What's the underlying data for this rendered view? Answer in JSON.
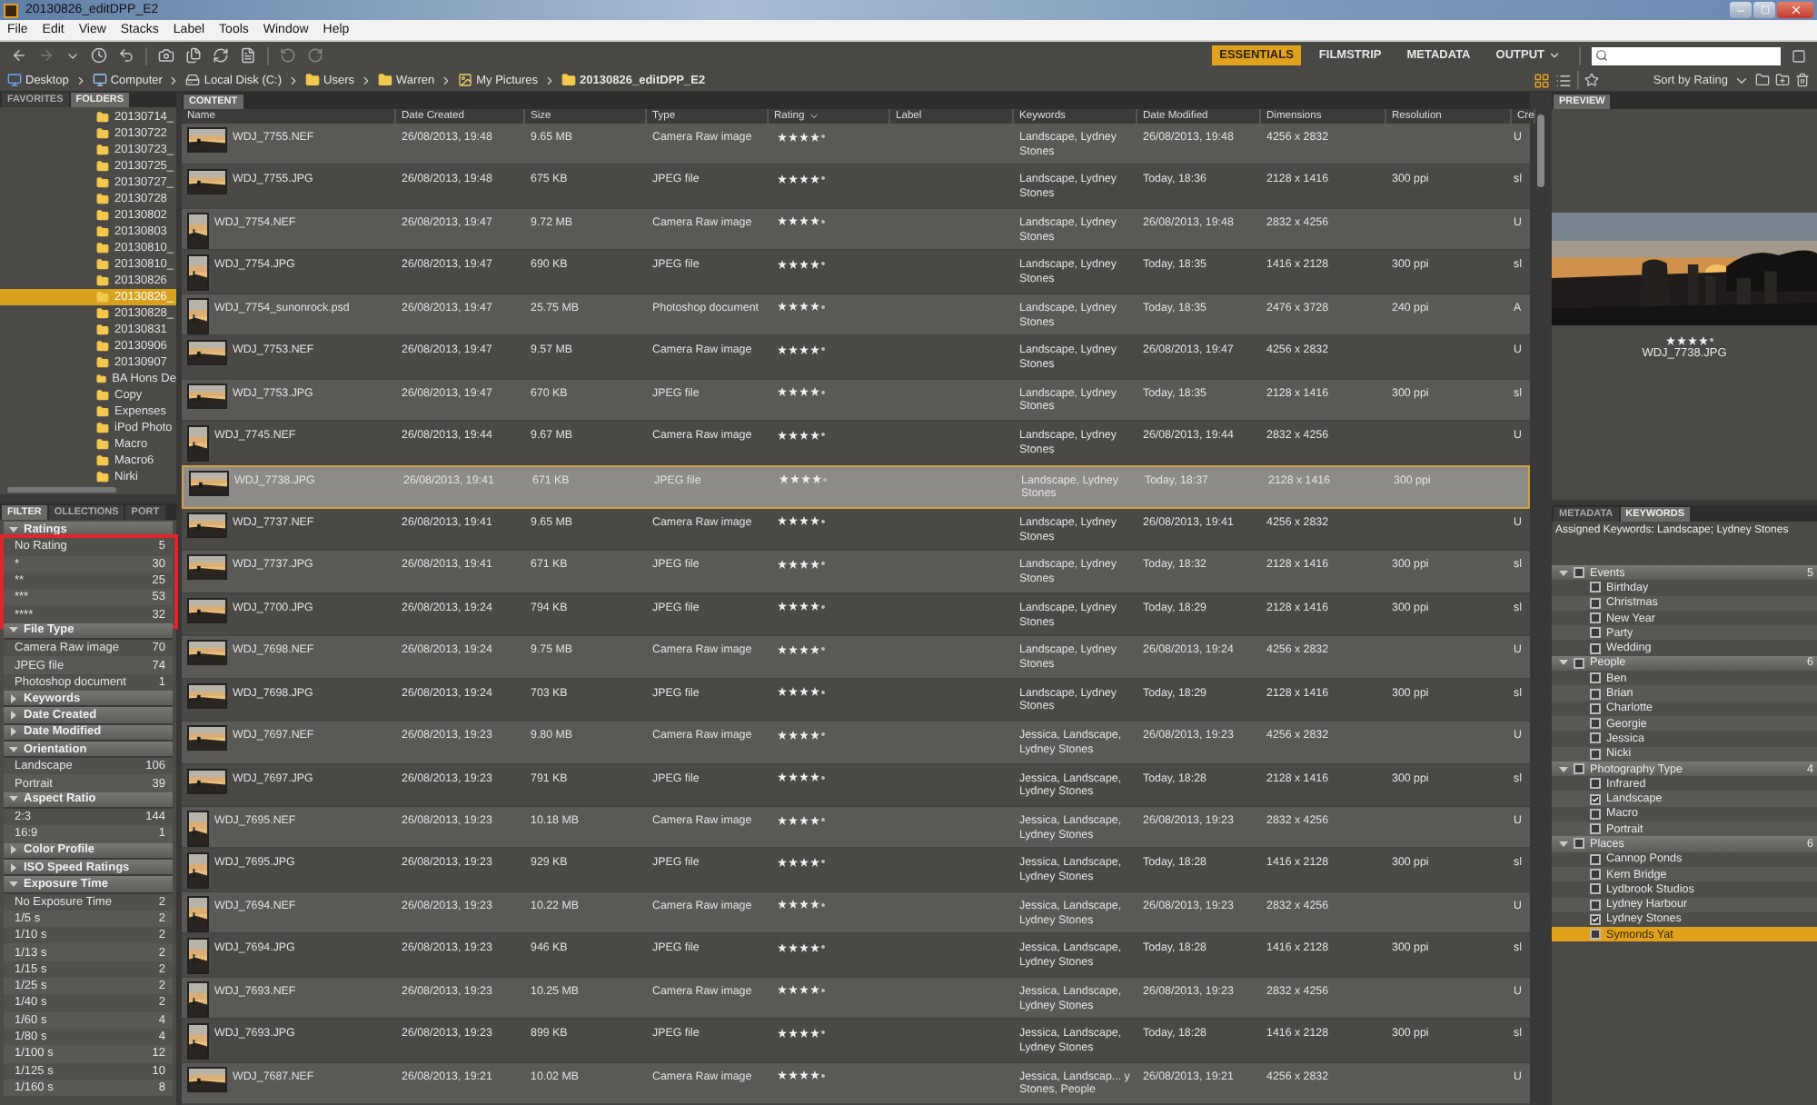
{
  "window": {
    "title": "20130826_editDPP_E2"
  },
  "menu": [
    "File",
    "Edit",
    "View",
    "Stacks",
    "Label",
    "Tools",
    "Window",
    "Help"
  ],
  "workspaces": [
    {
      "label": "ESSENTIALS",
      "selected": true
    },
    {
      "label": "FILMSTRIP",
      "selected": false
    },
    {
      "label": "METADATA",
      "selected": false
    },
    {
      "label": "OUTPUT",
      "selected": false
    }
  ],
  "path": [
    {
      "label": "Desktop",
      "kind": "desktop"
    },
    {
      "label": "Computer",
      "kind": "computer"
    },
    {
      "label": "Local Disk (C:)",
      "kind": "drive"
    },
    {
      "label": "Users",
      "kind": "folder"
    },
    {
      "label": "Warren",
      "kind": "folder"
    },
    {
      "label": "My Pictures",
      "kind": "pictures"
    },
    {
      "label": "20130826_editDPP_E2",
      "kind": "folder"
    }
  ],
  "sort": {
    "label": "Sort by Rating"
  },
  "folders_panel": {
    "tabs": [
      {
        "label": "FAVORITES",
        "selected": false
      },
      {
        "label": "FOLDERS",
        "selected": true
      }
    ],
    "items": [
      {
        "label": "20130714_",
        "selected": false
      },
      {
        "label": "20130722",
        "selected": false
      },
      {
        "label": "20130723_",
        "selected": false
      },
      {
        "label": "20130725_",
        "selected": false
      },
      {
        "label": "20130727_",
        "selected": false
      },
      {
        "label": "20130728",
        "selected": false
      },
      {
        "label": "20130802",
        "selected": false
      },
      {
        "label": "20130803",
        "selected": false
      },
      {
        "label": "20130810_",
        "selected": false
      },
      {
        "label": "20130810_",
        "selected": false
      },
      {
        "label": "20130826",
        "selected": false
      },
      {
        "label": "20130826_",
        "selected": true
      },
      {
        "label": "20130828_",
        "selected": false
      },
      {
        "label": "20130831",
        "selected": false
      },
      {
        "label": "20130906",
        "selected": false
      },
      {
        "label": "20130907",
        "selected": false
      },
      {
        "label": "BA Hons De",
        "selected": false
      },
      {
        "label": "Copy",
        "selected": false
      },
      {
        "label": "Expenses",
        "selected": false
      },
      {
        "label": "iPod Photo",
        "selected": false
      },
      {
        "label": "Macro",
        "selected": false
      },
      {
        "label": "Macro6",
        "selected": false
      },
      {
        "label": "Nirki",
        "selected": false
      }
    ]
  },
  "filter_panel": {
    "tabs": [
      {
        "label": "FILTER",
        "selected": true
      },
      {
        "label": "OLLECTIONS",
        "selected": false
      },
      {
        "label": "PORT",
        "selected": false
      }
    ],
    "sections": [
      {
        "title": "Ratings",
        "expanded": true,
        "highlighted": true,
        "items": [
          {
            "label": "No Rating",
            "count": "5"
          },
          {
            "label": "*",
            "count": "30"
          },
          {
            "label": "**",
            "count": "25"
          },
          {
            "label": "***",
            "count": "53"
          },
          {
            "label": "****",
            "count": "32"
          }
        ]
      },
      {
        "title": "File Type",
        "expanded": true,
        "items": [
          {
            "label": "Camera Raw image",
            "count": "70"
          },
          {
            "label": "JPEG file",
            "count": "74"
          },
          {
            "label": "Photoshop document",
            "count": "1"
          }
        ]
      },
      {
        "title": "Keywords",
        "expanded": false
      },
      {
        "title": "Date Created",
        "expanded": false
      },
      {
        "title": "Date Modified",
        "expanded": false
      },
      {
        "title": "Orientation",
        "expanded": true,
        "items": [
          {
            "label": "Landscape",
            "count": "106"
          },
          {
            "label": "Portrait",
            "count": "39"
          }
        ]
      },
      {
        "title": "Aspect Ratio",
        "expanded": true,
        "items": [
          {
            "label": "2:3",
            "count": "144"
          },
          {
            "label": "16:9",
            "count": "1"
          }
        ]
      },
      {
        "title": "Color Profile",
        "expanded": false
      },
      {
        "title": "ISO Speed Ratings",
        "expanded": false
      },
      {
        "title": "Exposure Time",
        "expanded": true,
        "items": [
          {
            "label": "No Exposure Time",
            "count": "2"
          },
          {
            "label": "1/5 s",
            "count": "2"
          },
          {
            "label": "1/10 s",
            "count": "2"
          },
          {
            "label": "1/13 s",
            "count": "2"
          },
          {
            "label": "1/15 s",
            "count": "2"
          },
          {
            "label": "1/25 s",
            "count": "2"
          },
          {
            "label": "1/40 s",
            "count": "2"
          },
          {
            "label": "1/60 s",
            "count": "4"
          },
          {
            "label": "1/80 s",
            "count": "4"
          },
          {
            "label": "1/100 s",
            "count": "12"
          },
          {
            "label": "1/125 s",
            "count": "10"
          },
          {
            "label": "1/160 s",
            "count": "8"
          }
        ]
      }
    ]
  },
  "content": {
    "tab": "CONTENT",
    "columns": [
      "Name",
      "Date Created",
      "Size",
      "Type",
      "Rating",
      "Label",
      "Keywords",
      "Date Modified",
      "Dimensions",
      "Resolution",
      "Cre"
    ],
    "rows": [
      {
        "kind": "landscape",
        "name": "WDJ_7755.NEF",
        "date_created": "26/08/2013, 19:48",
        "size": "9.65 MB",
        "type": "Camera Raw image",
        "stars": 4,
        "keywords": "Landscape, Lydney Stones",
        "date_modified": "26/08/2013, 19:48",
        "dimensions": "4256 x 2832",
        "column_11": "U",
        "selected": false
      },
      {
        "kind": "landscape",
        "name": "WDJ_7755.JPG",
        "date_created": "26/08/2013, 19:48",
        "size": "675 KB",
        "type": "JPEG file",
        "stars": 4,
        "keywords": "Landscape, Lydney Stones",
        "date_modified": "Today, 18:36",
        "dimensions": "2128 x 1416",
        "resolution": "300 ppi",
        "column_11": "sl",
        "selected": false
      },
      {
        "kind": "portrait",
        "name": "WDJ_7754.NEF",
        "date_created": "26/08/2013, 19:47",
        "size": "9.72 MB",
        "type": "Camera Raw image",
        "stars": 4,
        "keywords": "Landscape, Lydney Stones",
        "date_modified": "26/08/2013, 19:48",
        "dimensions": "2832 x 4256",
        "column_11": "U",
        "selected": false
      },
      {
        "kind": "portrait",
        "name": "WDJ_7754.JPG",
        "date_created": "26/08/2013, 19:47",
        "size": "690 KB",
        "type": "JPEG file",
        "stars": 4,
        "keywords": "Landscape, Lydney Stones",
        "date_modified": "Today, 18:35",
        "dimensions": "1416 x 2128",
        "resolution": "300 ppi",
        "column_11": "sl",
        "selected": false
      },
      {
        "kind": "portrait",
        "name": "WDJ_7754_sunonrock.psd",
        "date_created": "26/08/2013, 19:47",
        "size": "25.75 MB",
        "type": "Photoshop document",
        "stars": 4,
        "keywords": "Landscape, Lydney Stones",
        "date_modified": "Today, 18:35",
        "dimensions": "2476 x 3728",
        "resolution": "240 ppi",
        "column_11": "A",
        "selected": false
      },
      {
        "kind": "landscape",
        "name": "WDJ_7753.NEF",
        "date_created": "26/08/2013, 19:47",
        "size": "9.57 MB",
        "type": "Camera Raw image",
        "stars": 4,
        "keywords": "Landscape, Lydney Stones",
        "date_modified": "26/08/2013, 19:47",
        "dimensions": "4256 x 2832",
        "column_11": "U",
        "selected": false
      },
      {
        "kind": "landscape",
        "name": "WDJ_7753.JPG",
        "date_created": "26/08/2013, 19:47",
        "size": "670 KB",
        "type": "JPEG file",
        "stars": 4,
        "keywords": "Landscape, Lydney Stones",
        "date_modified": "Today, 18:35",
        "dimensions": "2128 x 1416",
        "resolution": "300 ppi",
        "column_11": "sl",
        "selected": false
      },
      {
        "kind": "portrait",
        "name": "WDJ_7745.NEF",
        "date_created": "26/08/2013, 19:44",
        "size": "9.67 MB",
        "type": "Camera Raw image",
        "stars": 4,
        "keywords": "Landscape, Lydney Stones",
        "date_modified": "26/08/2013, 19:44",
        "dimensions": "2832 x 4256",
        "column_11": "U",
        "selected": false
      },
      {
        "kind": "landscape",
        "name": "WDJ_7738.JPG",
        "date_created": "26/08/2013, 19:41",
        "size": "671 KB",
        "type": "JPEG file",
        "stars": 4,
        "keywords": "Landscape, Lydney Stones",
        "date_modified": "Today, 18:37",
        "dimensions": "2128 x 1416",
        "resolution": "300 ppi",
        "selected": true
      },
      {
        "kind": "landscape",
        "name": "WDJ_7737.NEF",
        "date_created": "26/08/2013, 19:41",
        "size": "9.65 MB",
        "type": "Camera Raw image",
        "stars": 4,
        "keywords": "Landscape, Lydney Stones",
        "date_modified": "26/08/2013, 19:41",
        "dimensions": "4256 x 2832",
        "column_11": "U",
        "selected": false
      },
      {
        "kind": "landscape",
        "name": "WDJ_7737.JPG",
        "date_created": "26/08/2013, 19:41",
        "size": "671 KB",
        "type": "JPEG file",
        "stars": 4,
        "keywords": "Landscape, Lydney Stones",
        "date_modified": "Today, 18:32",
        "dimensions": "2128 x 1416",
        "resolution": "300 ppi",
        "column_11": "sl",
        "selected": false
      },
      {
        "kind": "landscape",
        "name": "WDJ_7700.JPG",
        "date_created": "26/08/2013, 19:24",
        "size": "794 KB",
        "type": "JPEG file",
        "stars": 4,
        "keywords": "Landscape, Lydney Stones",
        "date_modified": "Today, 18:29",
        "dimensions": "2128 x 1416",
        "resolution": "300 ppi",
        "column_11": "sl",
        "selected": false
      },
      {
        "kind": "landscape",
        "name": "WDJ_7698.NEF",
        "date_created": "26/08/2013, 19:24",
        "size": "9.75 MB",
        "type": "Camera Raw image",
        "stars": 4,
        "keywords": "Landscape, Lydney Stones",
        "date_modified": "26/08/2013, 19:24",
        "dimensions": "4256 x 2832",
        "column_11": "U",
        "selected": false
      },
      {
        "kind": "landscape",
        "name": "WDJ_7698.JPG",
        "date_created": "26/08/2013, 19:24",
        "size": "703 KB",
        "type": "JPEG file",
        "stars": 4,
        "keywords": "Landscape, Lydney Stones",
        "date_modified": "Today, 18:29",
        "dimensions": "2128 x 1416",
        "resolution": "300 ppi",
        "column_11": "sl",
        "selected": false
      },
      {
        "kind": "landscape",
        "name": "WDJ_7697.NEF",
        "date_created": "26/08/2013, 19:23",
        "size": "9.80 MB",
        "type": "Camera Raw image",
        "stars": 4,
        "keywords": "Jessica, Landscape, Lydney Stones",
        "date_modified": "26/08/2013, 19:23",
        "dimensions": "4256 x 2832",
        "column_11": "U",
        "selected": false
      },
      {
        "kind": "landscape",
        "name": "WDJ_7697.JPG",
        "date_created": "26/08/2013, 19:23",
        "size": "791 KB",
        "type": "JPEG file",
        "stars": 4,
        "keywords": "Jessica, Landscape, Lydney Stones",
        "date_modified": "Today, 18:28",
        "dimensions": "2128 x 1416",
        "resolution": "300 ppi",
        "column_11": "sl",
        "selected": false
      },
      {
        "kind": "portrait",
        "name": "WDJ_7695.NEF",
        "date_created": "26/08/2013, 19:23",
        "size": "10.18 MB",
        "type": "Camera Raw image",
        "stars": 4,
        "keywords": "Jessica, Landscape, Lydney Stones",
        "date_modified": "26/08/2013, 19:23",
        "dimensions": "2832 x 4256",
        "column_11": "U",
        "selected": false
      },
      {
        "kind": "portrait",
        "name": "WDJ_7695.JPG",
        "date_created": "26/08/2013, 19:23",
        "size": "929 KB",
        "type": "JPEG file",
        "stars": 4,
        "keywords": "Jessica, Landscape, Lydney Stones",
        "date_modified": "Today, 18:28",
        "dimensions": "1416 x 2128",
        "resolution": "300 ppi",
        "column_11": "sl",
        "selected": false
      },
      {
        "kind": "portrait",
        "name": "WDJ_7694.NEF",
        "date_created": "26/08/2013, 19:23",
        "size": "10.22 MB",
        "type": "Camera Raw image",
        "stars": 4,
        "keywords": "Jessica, Landscape, Lydney Stones",
        "date_modified": "26/08/2013, 19:23",
        "dimensions": "2832 x 4256",
        "column_11": "U",
        "selected": false
      },
      {
        "kind": "portrait",
        "name": "WDJ_7694.JPG",
        "date_created": "26/08/2013, 19:23",
        "size": "946 KB",
        "type": "JPEG file",
        "stars": 4,
        "keywords": "Jessica, Landscape, Lydney Stones",
        "date_modified": "Today, 18:28",
        "dimensions": "1416 x 2128",
        "resolution": "300 ppi",
        "column_11": "sl",
        "selected": false
      },
      {
        "kind": "portrait",
        "name": "WDJ_7693.NEF",
        "date_created": "26/08/2013, 19:23",
        "size": "10.25 MB",
        "type": "Camera Raw image",
        "stars": 4,
        "keywords": "Jessica, Landscape, Lydney Stones",
        "date_modified": "26/08/2013, 19:23",
        "dimensions": "2832 x 4256",
        "column_11": "U",
        "selected": false
      },
      {
        "kind": "portrait",
        "name": "WDJ_7693.JPG",
        "date_created": "26/08/2013, 19:23",
        "size": "899 KB",
        "type": "JPEG file",
        "stars": 4,
        "keywords": "Jessica, Landscape, Lydney Stones",
        "date_modified": "Today, 18:28",
        "dimensions": "1416 x 2128",
        "resolution": "300 ppi",
        "column_11": "sl",
        "selected": false
      },
      {
        "kind": "landscape",
        "name": "WDJ_7687.NEF",
        "date_created": "26/08/2013, 19:21",
        "size": "10.02 MB",
        "type": "Camera Raw image",
        "stars": 4,
        "keywords": "Jessica, Landscap... y Stones, People",
        "date_modified": "26/08/2013, 19:21",
        "dimensions": "4256 x 2832",
        "column_11": "U",
        "selected": false
      }
    ]
  },
  "preview": {
    "tab": "PREVIEW",
    "stars": 4,
    "name": "WDJ_7738.JPG"
  },
  "keywords_panel": {
    "tabs": [
      {
        "label": "METADATA",
        "selected": false
      },
      {
        "label": "KEYWORDS",
        "selected": true
      }
    ],
    "assigned": "Assigned Keywords: Landscape; Lydney Stones",
    "groups": [
      {
        "label": "Events",
        "count": "5",
        "checked": false,
        "children": [
          {
            "label": "Birthday",
            "checked": false,
            "selected": false
          },
          {
            "label": "Christmas",
            "checked": false,
            "selected": false
          },
          {
            "label": "New Year",
            "checked": false,
            "selected": false
          },
          {
            "label": "Party",
            "checked": false,
            "selected": false
          },
          {
            "label": "Wedding",
            "checked": false,
            "selected": false
          }
        ]
      },
      {
        "label": "People",
        "count": "6",
        "checked": false,
        "children": [
          {
            "label": "Ben",
            "checked": false,
            "selected": false
          },
          {
            "label": "Brian",
            "checked": false,
            "selected": false
          },
          {
            "label": "Charlotte",
            "checked": false,
            "selected": false
          },
          {
            "label": "Georgie",
            "checked": false,
            "selected": false
          },
          {
            "label": "Jessica",
            "checked": false,
            "selected": false
          },
          {
            "label": "Nicki",
            "checked": false,
            "selected": false
          }
        ]
      },
      {
        "label": "Photography Type",
        "count": "4",
        "checked": false,
        "children": [
          {
            "label": "Infrared",
            "checked": false,
            "selected": false
          },
          {
            "label": "Landscape",
            "checked": true,
            "selected": false
          },
          {
            "label": "Macro",
            "checked": false,
            "selected": false
          },
          {
            "label": "Portrait",
            "checked": false,
            "selected": false
          }
        ]
      },
      {
        "label": "Places",
        "count": "6",
        "checked": false,
        "children": [
          {
            "label": "Cannop Ponds",
            "checked": false,
            "selected": false
          },
          {
            "label": "Kern Bridge",
            "checked": false,
            "selected": false
          },
          {
            "label": "Lydbrook Studios",
            "checked": false,
            "selected": false
          },
          {
            "label": "Lydney Harbour",
            "checked": false,
            "selected": false
          },
          {
            "label": "Lydney Stones",
            "checked": true,
            "selected": false
          },
          {
            "label": "Symonds Yat",
            "checked": false,
            "selected": true
          }
        ]
      }
    ]
  }
}
